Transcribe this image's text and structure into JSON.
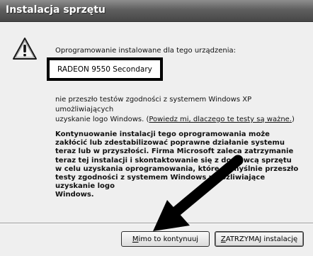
{
  "window": {
    "title": "Instalacja sprzętu"
  },
  "icons": {
    "warning": "warning-icon",
    "arrow": "arrow-annotation"
  },
  "message": {
    "intro": "Oprogramowanie instalowane dla tego urządzenia:",
    "device_name": "RADEON 9550 Secondary",
    "compat_line1": "nie przeszło testów zgodności z systemem Windows XP umożliwiających",
    "compat_line2_prefix": "uzyskanie logo Windows. (",
    "compat_link": "Powiedz mi, dlaczego te testy są ważne.",
    "compat_suffix": ")",
    "warning_lines": [
      "Kontynuowanie instalacji tego oprogramowania może",
      "zakłócić lub zdestabilizować poprawne działanie systemu",
      "teraz lub w przyszłości. Firma Microsoft zaleca zatrzymanie",
      "teraz tej instalacji i skontaktowanie się z dostawcą sprzętu",
      "w celu uzyskania oprogramowania, które pomyślnie przeszło",
      "testy zgodności z systemem Windows umożliwiające uzyskanie logo",
      "Windows."
    ]
  },
  "buttons": {
    "continue_mnemonic": "M",
    "continue_rest": "imo to kontynuuj",
    "stop_mnemonic": "Z",
    "stop_rest": "ATRZYMAJ instalację"
  }
}
